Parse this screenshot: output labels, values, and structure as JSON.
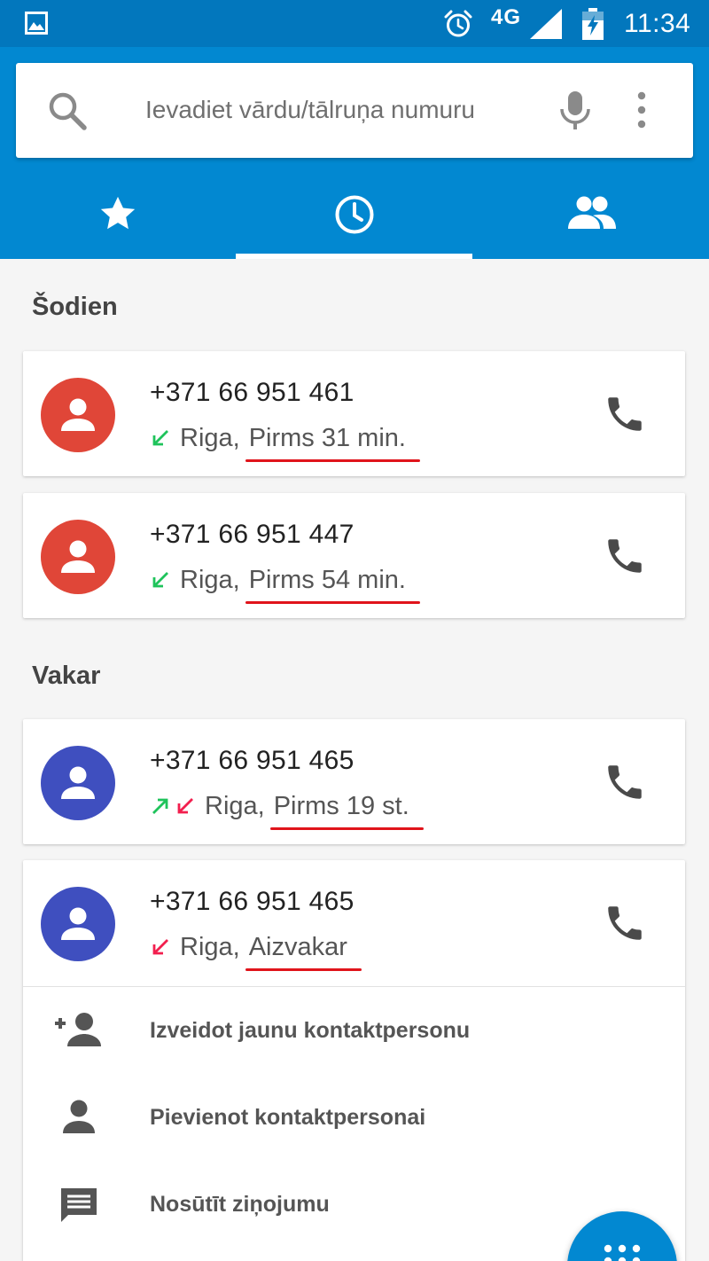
{
  "status_bar": {
    "network": "4G",
    "time": "11:34"
  },
  "search": {
    "placeholder": "Ievadiet vārdu/tālruņa numuru",
    "value": ""
  },
  "tabs": [
    {
      "icon": "star-icon",
      "selected": false
    },
    {
      "icon": "clock-icon",
      "selected": true
    },
    {
      "icon": "people-icon",
      "selected": false
    }
  ],
  "colors": {
    "accent": "#0288d1",
    "avatar_red": "#e04638",
    "avatar_blue": "#3f4fbf",
    "incoming_green": "#1fc35b",
    "missed_red": "#f21f4e",
    "underline_red": "#e0141b"
  },
  "sections": {
    "today": "Šodien",
    "yesterday": "Vakar"
  },
  "calls": [
    {
      "number": "+371 66 951 461",
      "location": "Riga,",
      "ago": "Pirms 31 min.",
      "types": [
        "incoming"
      ],
      "avatar_color": "red"
    },
    {
      "number": "+371 66 951 447",
      "location": "Riga,",
      "ago": "Pirms 54 min.",
      "types": [
        "incoming"
      ],
      "avatar_color": "red"
    },
    {
      "number": "+371 66 951 465",
      "location": "Riga,",
      "ago": "Pirms 19 st.",
      "types": [
        "outgoing",
        "missed"
      ],
      "avatar_color": "blue"
    },
    {
      "number": "+371 66 951 465",
      "location": "Riga,",
      "ago": "Aizvakar",
      "types": [
        "missed"
      ],
      "avatar_color": "blue"
    }
  ],
  "actions": {
    "create_contact": "Izveidot jaunu kontaktpersonu",
    "add_to_contact": "Pievienot kontaktpersonai",
    "send_message": "Nosūtīt ziņojumu"
  }
}
